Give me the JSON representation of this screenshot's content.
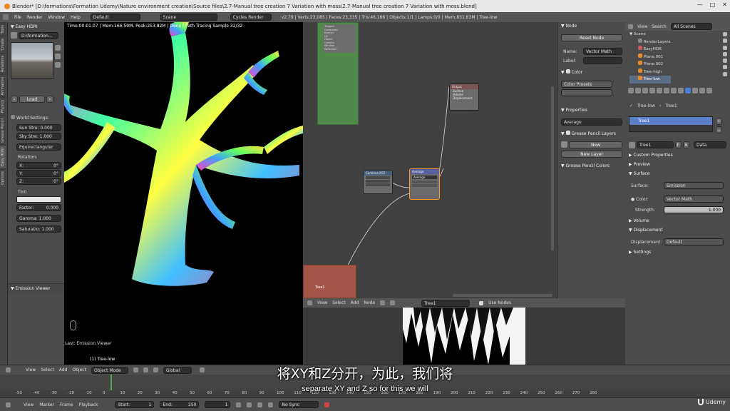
{
  "title": "Blender* [D:\\formations\\Formation Udemy\\Nature environment creation\\Source files\\2.7-Manual tree creation 7 Variation with moss\\2.7-Manual tree creation 7 Variation with moss.blend]",
  "menu": {
    "file": "File",
    "render": "Render",
    "window": "Window",
    "help": "Help",
    "layout": "Default",
    "scene": "Scene",
    "engine": "Cycles Render",
    "stats": "v2.79 | Verts:23,085 | Faces:23,335 | Tris:46,166 | Objects:1/1 | Lamps:0/0 | Mem:831.63M | Tree-low"
  },
  "vtabs": [
    "Tools",
    "Create",
    "Relations",
    "Animation",
    "Physics",
    "Grease Pencil",
    "Easy HDRI",
    "Options"
  ],
  "left": {
    "panel_title": "Easy HDRI",
    "file": "D:\\formation...",
    "load": "Load",
    "world_settings": "World Settings:",
    "sun": "Sun Stre: 0.000",
    "sky": "Sky Stre: 1.000",
    "proj": "Equirectangular",
    "rotation": "Rotation:",
    "x": "X:",
    "y": "Y:",
    "z": "Z:",
    "deg": "0°",
    "tint": "Tint:",
    "factor": "Factor:",
    "factor_v": "0.000",
    "gamma": "Gamma: 1.000",
    "saturation": "Saturatio: 1.000",
    "emission_viewer": "Emission Viewer"
  },
  "viewport": {
    "info": "Time:00:01.07 | Mem:166.59M, Peak:253.82M | Done | Path Tracing Sample 32/32",
    "last_op": "Last: Emission Viewer",
    "object": "(1) Tree-low"
  },
  "nodes": {
    "n1": "Combine XYZ",
    "n2": "Average",
    "n3": "Output",
    "frame_label": "Tree1",
    "top_sockets": [
      "Tangent",
      "Generated",
      "Normal",
      "UV",
      "Object",
      "Camera",
      "Window",
      "Reflection"
    ],
    "out_sockets": [
      "Surface",
      "Volume",
      "Displacement"
    ]
  },
  "node_panel": {
    "node_hdr": "Node",
    "reset": "Reset Node",
    "name_lbl": "Name:",
    "name_v": "Vector Math",
    "label_lbl": "Label:",
    "color_hdr": "Color",
    "color_presets": "Color Presets",
    "properties_hdr": "Properties",
    "average": "Average",
    "gp_layers": "Grease Pencil Layers",
    "new": "New",
    "new_layer": "New Layer",
    "gp_colors": "Grease Pencil Colors"
  },
  "outliner": {
    "view": "View",
    "search": "Search",
    "all_scenes": "All Scenes",
    "items": [
      "Scene",
      "RenderLayers",
      "EasyHDR",
      "Plane.001",
      "Plane.002",
      "Tree-high",
      "Tree-low"
    ]
  },
  "props": {
    "breadcrumb_obj": "Tree-low",
    "breadcrumb_mat": "Tree1",
    "material": "Tree1",
    "mat_field": "Tree1",
    "data": "Data",
    "custom_props": "Custom Properties",
    "preview": "Preview",
    "surface_hdr": "Surface",
    "surface_lbl": "Surface:",
    "surface_v": "Emission",
    "color_lbl": "Color:",
    "color_v": "Vector Math",
    "strength_lbl": "Strength:",
    "strength_v": "1.000",
    "volume": "Volume",
    "displacement_hdr": "Displacement",
    "disp_lbl": "Displacement:",
    "disp_v": "Default",
    "settings": "Settings"
  },
  "img_editor": {
    "view": "View",
    "select": "Select",
    "add": "Add",
    "node": "Node",
    "mat": "Tree1",
    "use_nodes": "Use Nodes"
  },
  "bottom": {
    "view": "View",
    "select": "Select",
    "add": "Add",
    "object": "Object",
    "mode": "Object Mode",
    "global": "Global"
  },
  "timeline": {
    "ticks": [
      "-50",
      "-40",
      "-30",
      "-20",
      "-10",
      "0",
      "10",
      "20",
      "30",
      "40",
      "50",
      "60",
      "70",
      "80",
      "90",
      "100",
      "110",
      "120",
      "130",
      "140",
      "150",
      "160",
      "170",
      "180",
      "190",
      "200",
      "210",
      "220",
      "230",
      "240",
      "250",
      "260",
      "270",
      "280"
    ]
  },
  "timectrl": {
    "view": "View",
    "marker": "Marker",
    "frame": "Frame",
    "playback": "Playback",
    "start": "Start:",
    "start_v": "1",
    "end": "End:",
    "end_v": "250",
    "current": "1",
    "sync": "No Sync"
  },
  "subtitle": {
    "cn": "将XY和Z分开，为此，我们将",
    "en": "separate XY and Z so for this we will"
  },
  "brand": "Udemy"
}
